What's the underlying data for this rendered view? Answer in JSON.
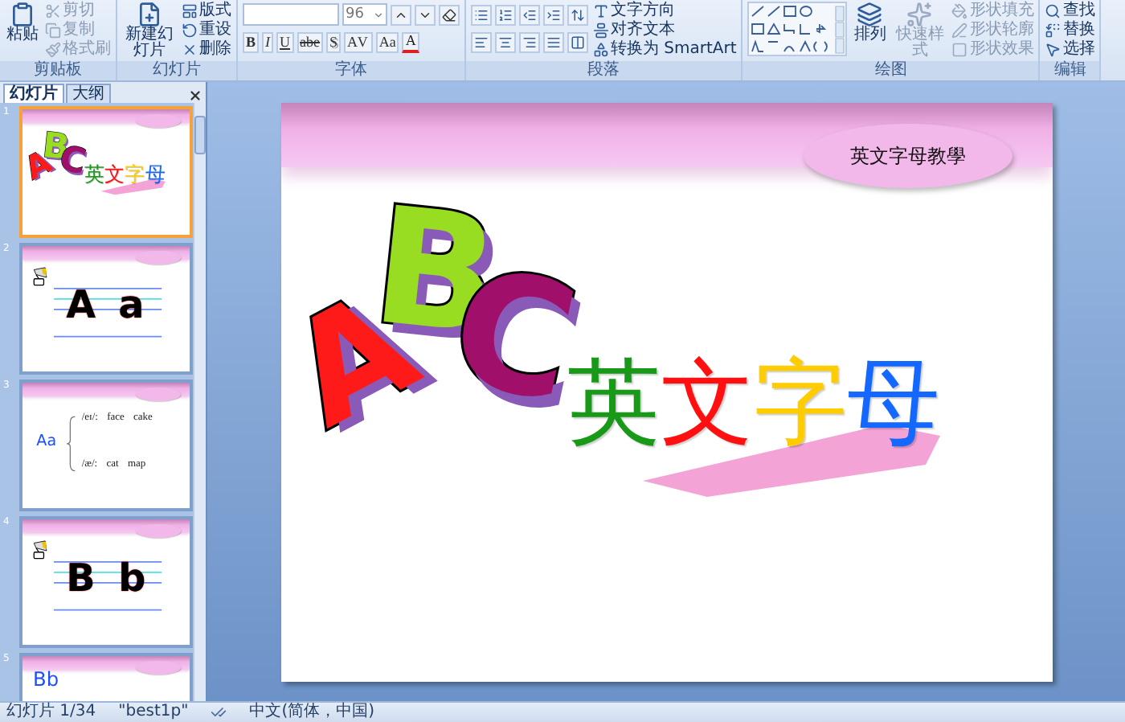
{
  "ribbon": {
    "groups": [
      {
        "label": "剪贴板",
        "columns": [
          [
            {
              "kind": "large",
              "label": "粘贴",
              "disabled": false
            }
          ],
          [
            {
              "kind": "small",
              "label": "剪切",
              "disabled": true
            },
            {
              "kind": "small",
              "label": "复制",
              "disabled": true
            },
            {
              "kind": "small",
              "label": "格式刷",
              "disabled": true
            }
          ]
        ]
      },
      {
        "label": "幻灯片",
        "columns": [
          [
            {
              "kind": "large",
              "label": "新建幻灯片",
              "disabled": false
            }
          ],
          [
            {
              "kind": "small",
              "label": "版式",
              "disabled": false
            },
            {
              "kind": "small",
              "label": "重设",
              "disabled": false
            },
            {
              "kind": "small",
              "label": "删除",
              "disabled": false
            }
          ]
        ]
      },
      {
        "label": "字体",
        "columns": [
          [
            {
              "kind": "font-row",
              "size": "96"
            },
            {
              "kind": "glyph-row",
              "glyphs": [
                "B",
                "I",
                "U",
                "abe",
                "S",
                "AV",
                "Aa",
                "A"
              ]
            }
          ]
        ]
      },
      {
        "label": "段落",
        "columns": [
          [
            {
              "kind": "list-tools"
            },
            {
              "kind": "align-tools"
            }
          ],
          [
            {
              "kind": "small",
              "label": "文字方向",
              "disabled": false
            },
            {
              "kind": "small",
              "label": "对齐文本",
              "disabled": false
            },
            {
              "kind": "small",
              "label": "转换为 SmartArt",
              "disabled": false
            }
          ]
        ]
      },
      {
        "label": "绘图",
        "columns": [
          [
            {
              "kind": "shape-gallery"
            }
          ],
          [
            {
              "kind": "large",
              "label": "排列",
              "disabled": false
            }
          ],
          [
            {
              "kind": "large",
              "label": "快速样式",
              "disabled": true
            }
          ],
          [
            {
              "kind": "small",
              "label": "形状填充",
              "disabled": true
            },
            {
              "kind": "small",
              "label": "形状轮廓",
              "disabled": true
            },
            {
              "kind": "small",
              "label": "形状效果",
              "disabled": true
            }
          ]
        ]
      },
      {
        "label": "编辑",
        "columns": [
          [
            {
              "kind": "small",
              "label": "查找",
              "disabled": false
            },
            {
              "kind": "small",
              "label": "替换",
              "disabled": false
            },
            {
              "kind": "small",
              "label": "选择",
              "disabled": false
            }
          ]
        ]
      }
    ]
  },
  "panel_tabs": [
    {
      "label": "幻灯片",
      "selected": true
    },
    {
      "label": "大纲",
      "selected": false
    }
  ],
  "slides": [
    {
      "number": "1",
      "selected": true,
      "kind": "title",
      "clipart_letters": [
        {
          "char": "A",
          "color": "#ff1a1a"
        },
        {
          "char": "B",
          "color": "#99dd22"
        },
        {
          "char": "C",
          "color": "#a0106a"
        }
      ],
      "title_chars": [
        {
          "char": "英",
          "color": "#189a18"
        },
        {
          "char": "文",
          "color": "#ff1010"
        },
        {
          "char": "字",
          "color": "#ffcc00"
        },
        {
          "char": "母",
          "color": "#1468ff"
        }
      ]
    },
    {
      "number": "2",
      "selected": false,
      "kind": "letter",
      "upper": "A",
      "lower": "a"
    },
    {
      "number": "3",
      "selected": false,
      "kind": "phonics",
      "letter": "Aa",
      "sounds": [
        {
          "symbol": "/eɪ/:",
          "words": [
            "face",
            "cake"
          ]
        },
        {
          "symbol": "/æ/:",
          "words": [
            "cat",
            "map"
          ]
        }
      ]
    },
    {
      "number": "4",
      "selected": false,
      "kind": "letter",
      "upper": "B",
      "lower": "b"
    },
    {
      "number": "5",
      "selected": false,
      "kind": "heading",
      "letter": "Bb"
    }
  ],
  "editor_slide": {
    "kind": "title",
    "badge": "英文字母教學",
    "clipart_letters": [
      {
        "char": "A",
        "color": "#ff1a1a"
      },
      {
        "char": "B",
        "color": "#99dd22"
      },
      {
        "char": "C",
        "color": "#a0106a"
      }
    ],
    "title_chars": [
      {
        "char": "英",
        "color": "#189a18"
      },
      {
        "char": "文",
        "color": "#ff1010"
      },
      {
        "char": "字",
        "color": "#ffcc00"
      },
      {
        "char": "母",
        "color": "#1468ff"
      }
    ]
  },
  "status_bar": {
    "slide": "幻灯片 1/34",
    "theme": "\"best1p\"",
    "language": "中文(简体，中国)"
  }
}
